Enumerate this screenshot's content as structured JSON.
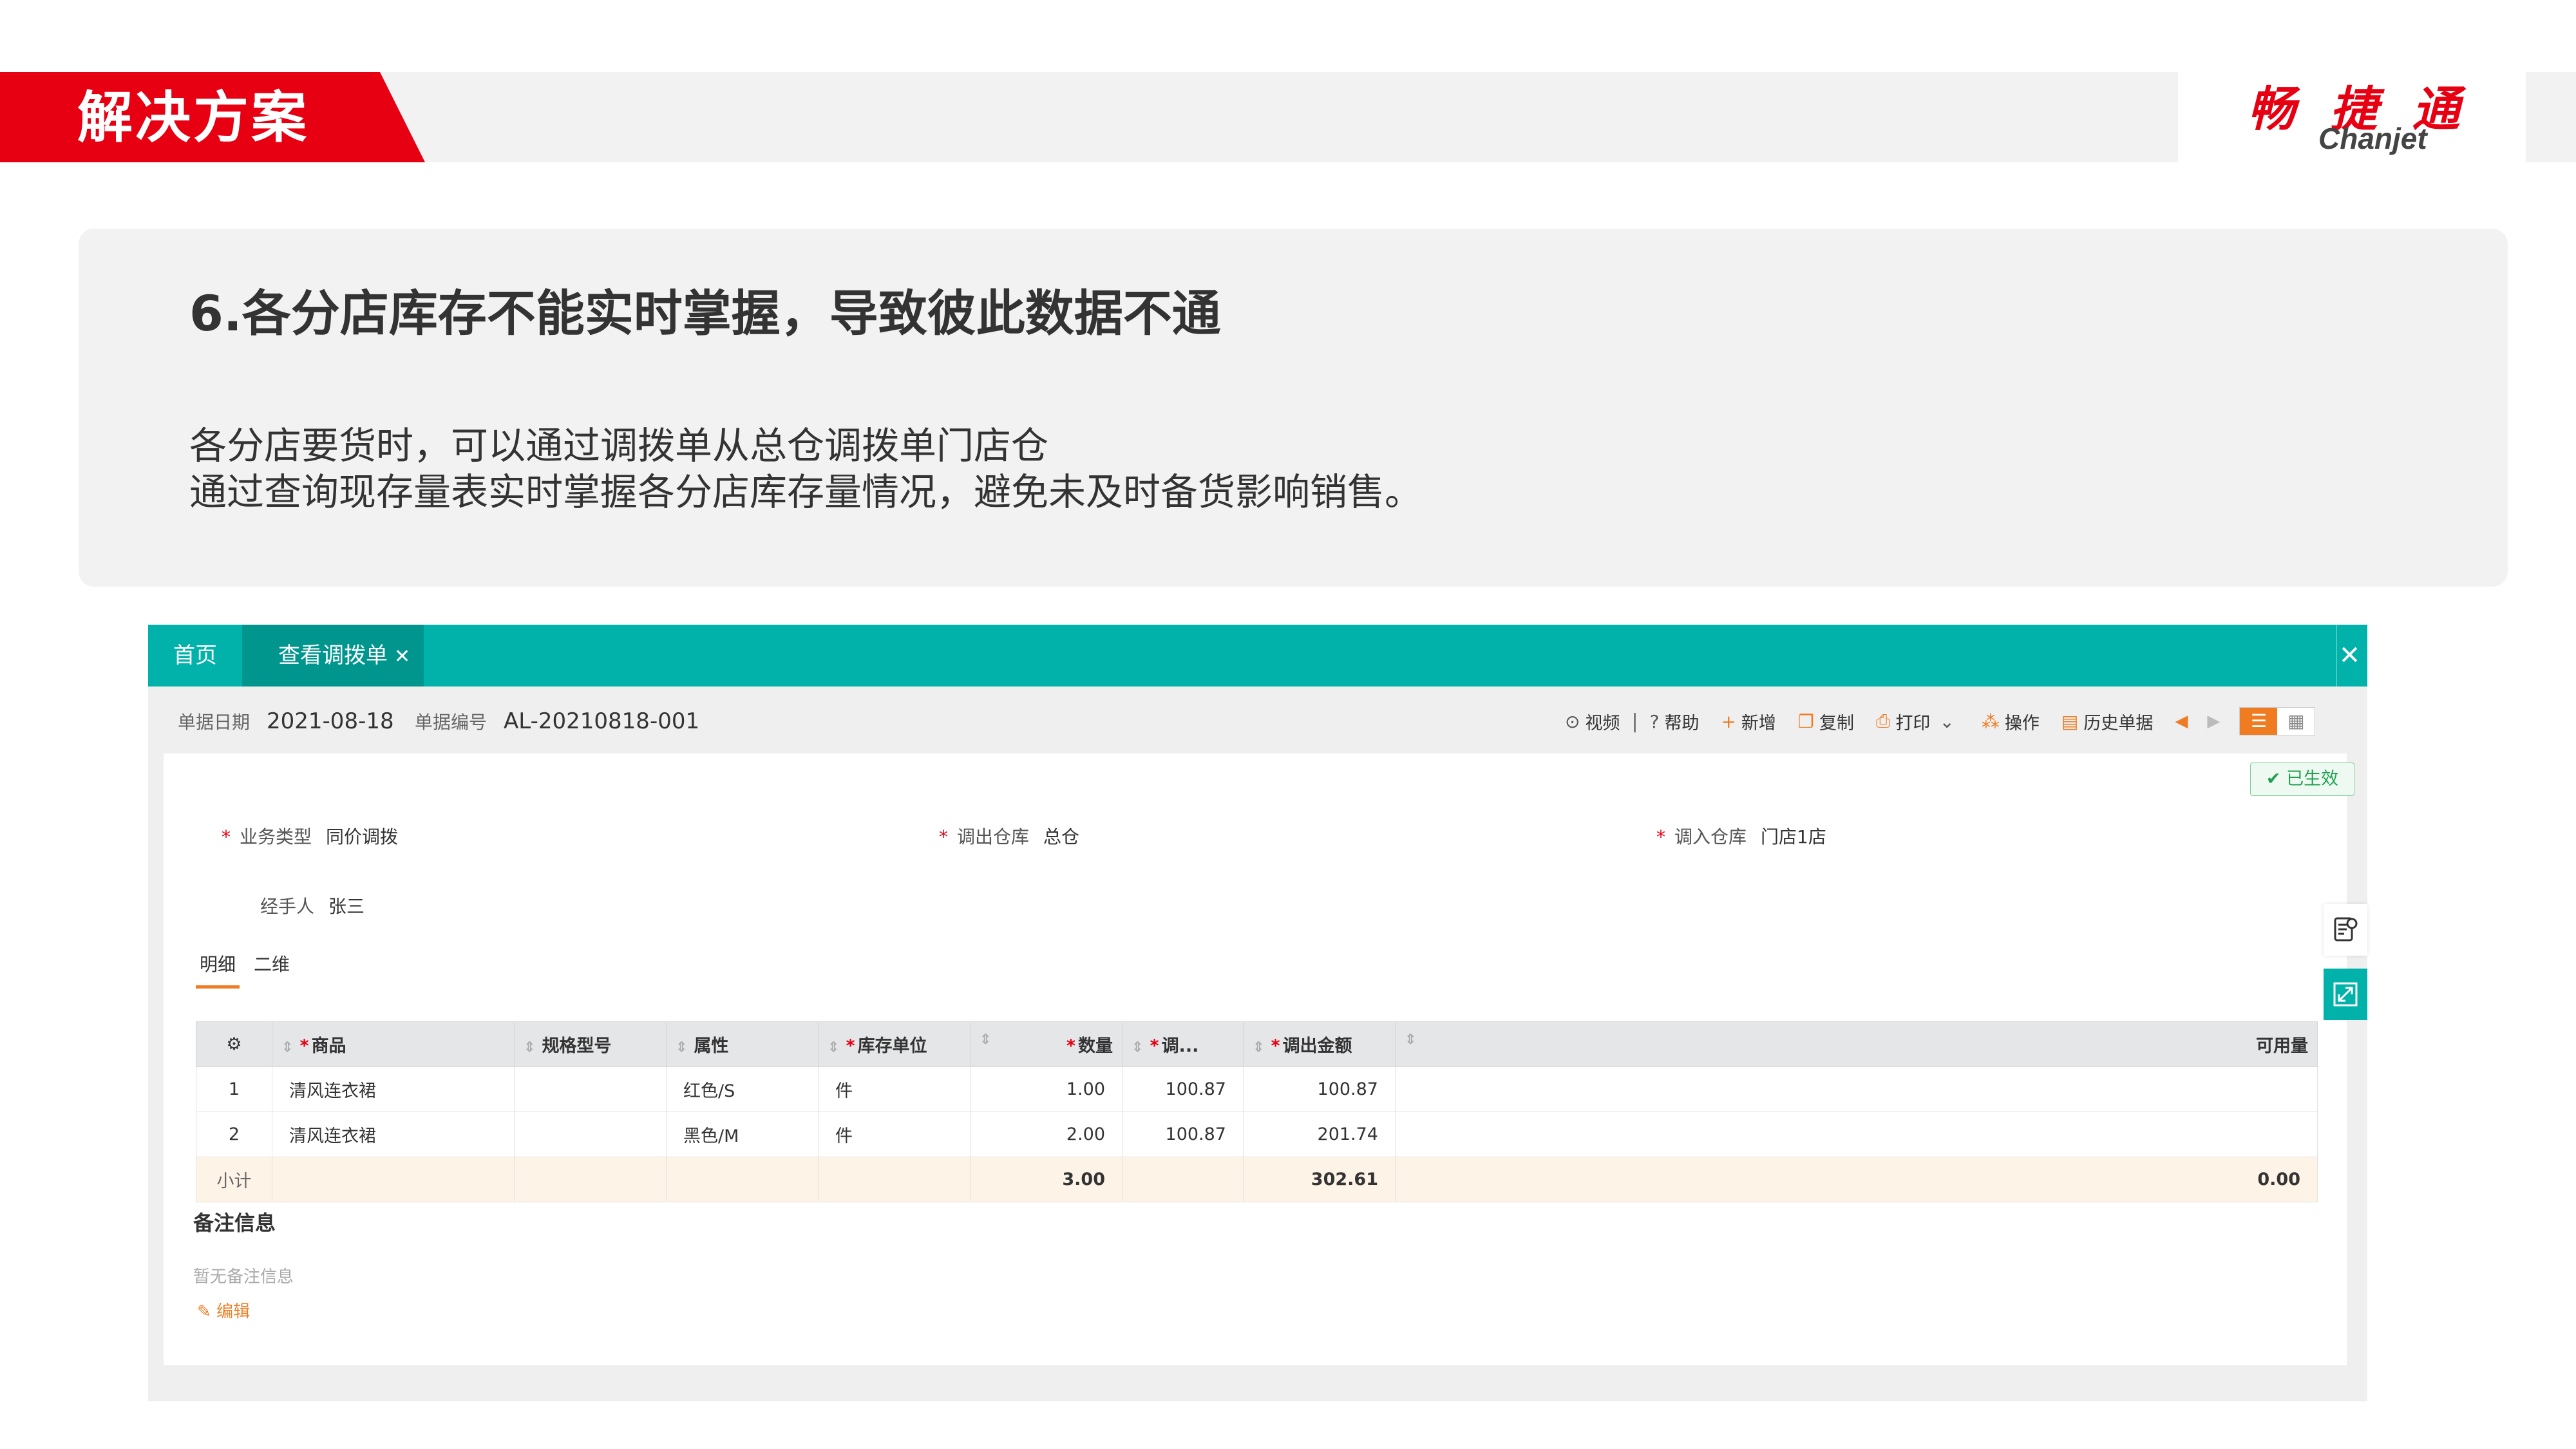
{
  "slide": {
    "section_title": "解决方案",
    "logo_cn": "畅 捷 通",
    "logo_en": "Chanjet",
    "heading": "6.各分店库存不能实时掌握，导致彼此数据不通",
    "body_line1": "各分店要货时，可以通过调拨单从总仓调拨单门店仓",
    "body_line2": "通过查询现存量表实时掌握各分店库存量情况，避免未及时备货影响销售。"
  },
  "app": {
    "tabs": {
      "home": "首页",
      "active": "查看调拨单"
    },
    "meta": {
      "date_label": "单据日期",
      "date_value": "2021-08-18",
      "code_label": "单据编号",
      "code_value": "AL-20210818-001"
    },
    "toolbar": {
      "video": "视频",
      "help": "帮助",
      "add": "新增",
      "copy": "复制",
      "print": "打印",
      "operate": "操作",
      "history": "历史单据"
    },
    "status": "已生效",
    "fields": {
      "biz_type_label": "业务类型",
      "biz_type_value": "同价调拨",
      "out_wh_label": "调出仓库",
      "out_wh_value": "总仓",
      "in_wh_label": "调入仓库",
      "in_wh_value": "门店1店",
      "handler_label": "经手人",
      "handler_value": "张三"
    },
    "subtabs": {
      "detail": "明细",
      "dimension": "二维"
    },
    "table": {
      "headers": {
        "product": "商品",
        "spec": "规格型号",
        "attr": "属性",
        "unit": "库存单位",
        "qty": "数量",
        "price": "调...",
        "amount": "调出金额",
        "available": "可用量"
      },
      "rows": [
        {
          "no": "1",
          "product": "清风连衣裙",
          "spec": "",
          "attr": "红色/S",
          "unit": "件",
          "qty": "1.00",
          "price": "100.87",
          "amount": "100.87",
          "available": ""
        },
        {
          "no": "2",
          "product": "清风连衣裙",
          "spec": "",
          "attr": "黑色/M",
          "unit": "件",
          "qty": "2.00",
          "price": "100.87",
          "amount": "201.74",
          "available": ""
        }
      ],
      "subtotal": {
        "label": "小计",
        "qty": "3.00",
        "amount": "302.61",
        "available": "0.00"
      }
    },
    "remarks": {
      "title": "备注信息",
      "empty": "暂无备注信息",
      "edit": "编辑"
    }
  },
  "colors": {
    "brand_red": "#e60012",
    "teal": "#00b2a9",
    "accent_orange": "#f07c22"
  }
}
